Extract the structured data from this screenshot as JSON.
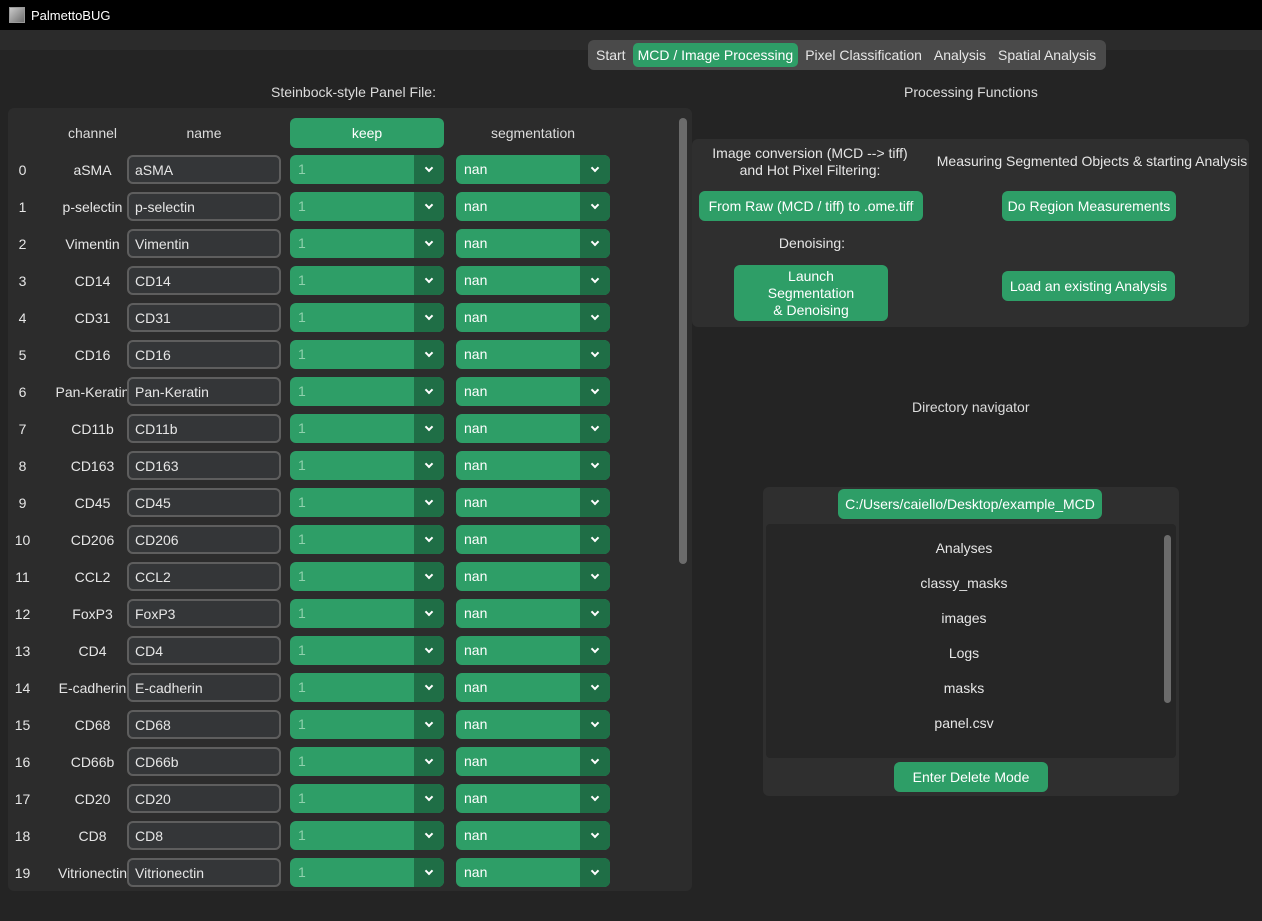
{
  "window": {
    "title": "PalmettoBUG"
  },
  "tabs": [
    "Start",
    "MCD / Image Processing",
    "Pixel Classification",
    "Analysis",
    "Spatial Analysis"
  ],
  "active_tab": 1,
  "panel": {
    "title": "Steinbock-style Panel File:",
    "headers": {
      "channel": "channel",
      "name": "name",
      "keep": "keep",
      "segmentation": "segmentation"
    },
    "rows": [
      {
        "idx": "0",
        "channel": "aSMA",
        "name": "aSMA",
        "keep": "1",
        "seg": "nan"
      },
      {
        "idx": "1",
        "channel": "p-selectin",
        "name": "p-selectin",
        "keep": "1",
        "seg": "nan"
      },
      {
        "idx": "2",
        "channel": "Vimentin",
        "name": "Vimentin",
        "keep": "1",
        "seg": "nan"
      },
      {
        "idx": "3",
        "channel": "CD14",
        "name": "CD14",
        "keep": "1",
        "seg": "nan"
      },
      {
        "idx": "4",
        "channel": "CD31",
        "name": "CD31",
        "keep": "1",
        "seg": "nan"
      },
      {
        "idx": "5",
        "channel": "CD16",
        "name": "CD16",
        "keep": "1",
        "seg": "nan"
      },
      {
        "idx": "6",
        "channel": "Pan-Keratin",
        "name": "Pan-Keratin",
        "keep": "1",
        "seg": "nan"
      },
      {
        "idx": "7",
        "channel": "CD11b",
        "name": "CD11b",
        "keep": "1",
        "seg": "nan"
      },
      {
        "idx": "8",
        "channel": "CD163",
        "name": "CD163",
        "keep": "1",
        "seg": "nan"
      },
      {
        "idx": "9",
        "channel": "CD45",
        "name": "CD45",
        "keep": "1",
        "seg": "nan"
      },
      {
        "idx": "10",
        "channel": "CD206",
        "name": "CD206",
        "keep": "1",
        "seg": "nan"
      },
      {
        "idx": "11",
        "channel": "CCL2",
        "name": "CCL2",
        "keep": "1",
        "seg": "nan"
      },
      {
        "idx": "12",
        "channel": "FoxP3",
        "name": "FoxP3",
        "keep": "1",
        "seg": "nan"
      },
      {
        "idx": "13",
        "channel": "CD4",
        "name": "CD4",
        "keep": "1",
        "seg": "nan"
      },
      {
        "idx": "14",
        "channel": "E-cadherin",
        "name": "E-cadherin",
        "keep": "1",
        "seg": "nan"
      },
      {
        "idx": "15",
        "channel": "CD68",
        "name": "CD68",
        "keep": "1",
        "seg": "nan"
      },
      {
        "idx": "16",
        "channel": "CD66b",
        "name": "CD66b",
        "keep": "1",
        "seg": "nan"
      },
      {
        "idx": "17",
        "channel": "CD20",
        "name": "CD20",
        "keep": "1",
        "seg": "nan"
      },
      {
        "idx": "18",
        "channel": "CD8",
        "name": "CD8",
        "keep": "1",
        "seg": "nan"
      },
      {
        "idx": "19",
        "channel": "Vitrionectin",
        "name": "Vitrionectin",
        "keep": "1",
        "seg": "nan"
      }
    ]
  },
  "processing": {
    "title": "Processing Functions",
    "image_conversion_label": "Image conversion (MCD --> tiff)\nand Hot Pixel Filtering:",
    "convert_button": "From Raw (MCD / tiff) to .ome.tiff",
    "denoising_label": "Denoising:",
    "launch_button": "Launch\nSegmentation\n& Denoising",
    "measuring_label": "Measuring Segmented Objects & starting Analysis",
    "region_button": "Do Region Measurements",
    "load_button": "Load an existing Analysis"
  },
  "directory": {
    "title": "Directory navigator",
    "path": "C:/Users/caiello/Desktop/example_MCD",
    "items": [
      "Analyses",
      "classy_masks",
      "images",
      "Logs",
      "masks",
      "panel.csv"
    ],
    "delete_button": "Enter Delete Mode"
  },
  "colors": {
    "accent": "#2e9e67",
    "accent_dark": "#1f6e46",
    "background": "#242424"
  },
  "icons": {
    "app": "palmettobug-app-icon",
    "dropdown": "chevron-down-icon"
  }
}
